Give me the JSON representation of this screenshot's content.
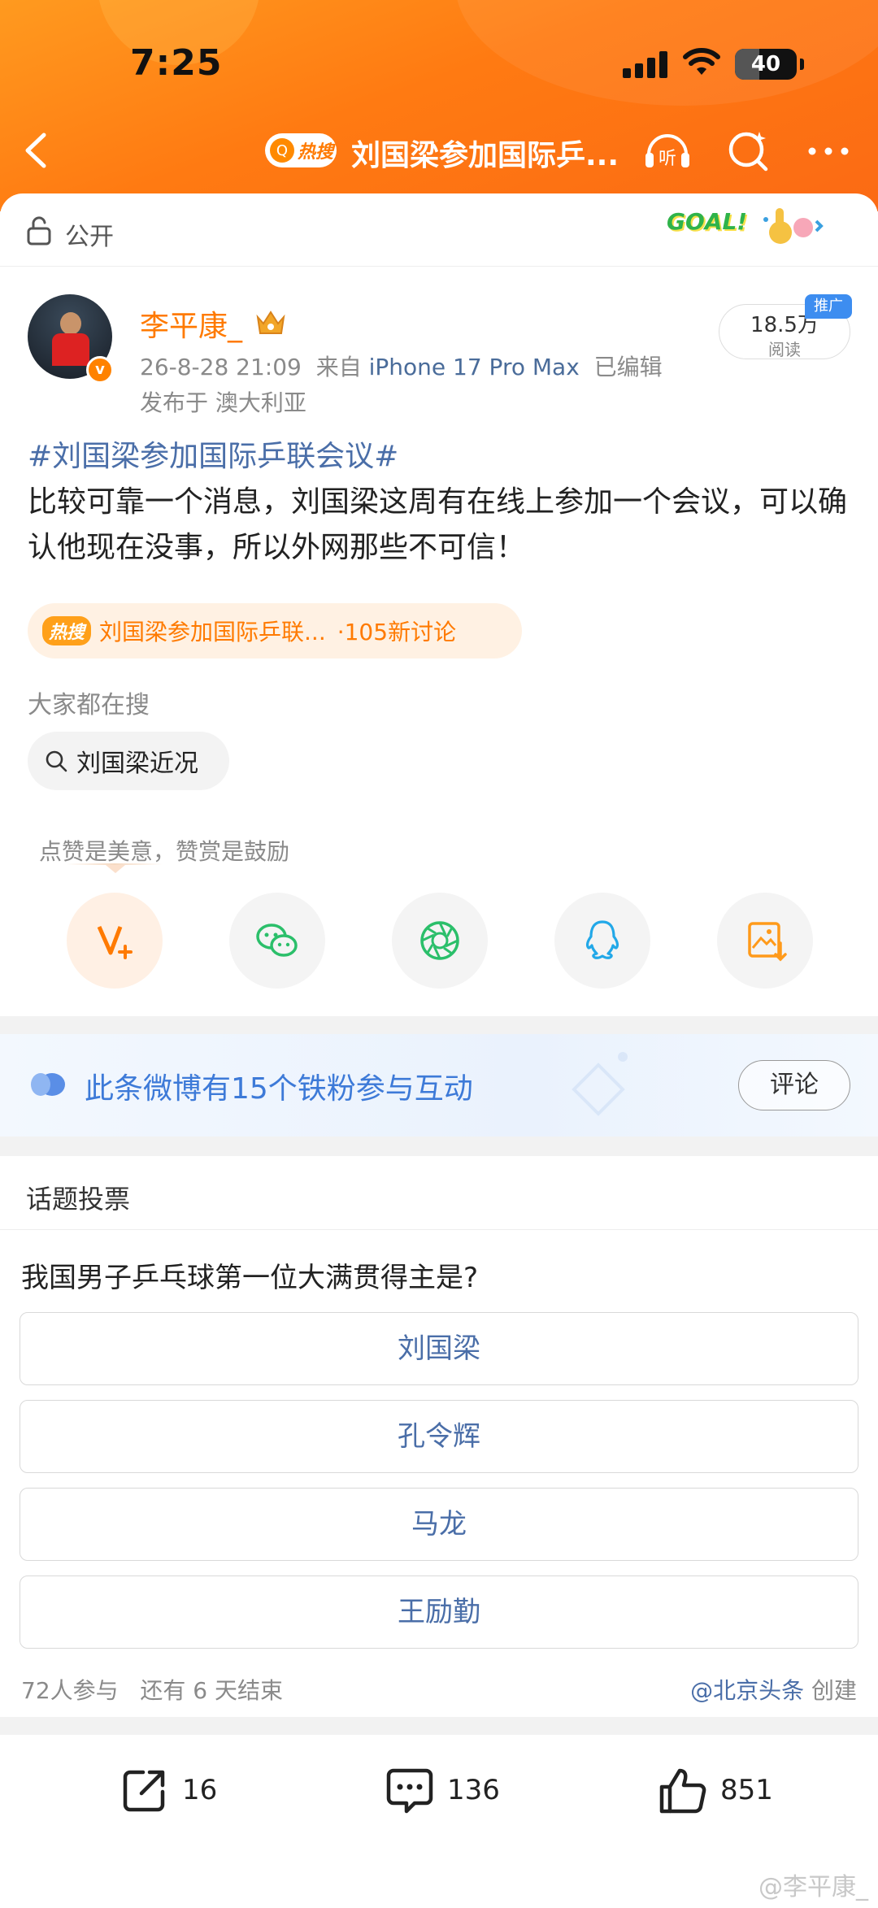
{
  "status_bar": {
    "time": "7:25",
    "battery": "40"
  },
  "header": {
    "hot_badge": "热搜",
    "title": "刘国梁参加国际乒...",
    "listen_label": "听"
  },
  "privacy": {
    "label": "公开",
    "goal_text": "GOAL!"
  },
  "post": {
    "author": "李平康_",
    "verified_mark": "v",
    "date": "26-8-28 21:09",
    "source_prefix": "来自",
    "device": "iPhone 17 Pro Max",
    "edited": "已编辑",
    "location": "发布于 澳大利亚",
    "reads_count": "18.5万",
    "reads_label": "阅读",
    "promo_badge": "推广",
    "hashtag": "#刘国梁参加国际乒联会议#",
    "body": "比较可靠一个消息，刘国梁这周有在线上参加一个会议，可以确认他现在没事，所以外网那些不可信！"
  },
  "hot_topic": {
    "badge": "热搜",
    "text": "刘国梁参加国际乒联...",
    "count": "·105新讨论"
  },
  "searches": {
    "label": "大家都在搜",
    "chip": "刘国梁近况"
  },
  "reward": {
    "tip": "点赞是美意，赞赏是鼓励"
  },
  "share_icons": [
    "reward-v-plus-icon",
    "wechat-icon",
    "moments-icon",
    "qq-icon",
    "save-image-icon"
  ],
  "fans": {
    "text": "此条微博有15个铁粉参与互动",
    "button": "评论"
  },
  "vote": {
    "header": "话题投票",
    "question": "我国男子乒乓球第一位大满贯得主是?",
    "options": [
      "刘国梁",
      "孔令辉",
      "马龙",
      "王励勤"
    ],
    "participants": "72人参与",
    "remaining": "还有 6 天结束",
    "creator_account": "@北京头条",
    "creator_suffix": "创建"
  },
  "actions": {
    "repost_count": "16",
    "comment_count": "136",
    "like_count": "851"
  },
  "watermark": "@李平康_",
  "colors": {
    "brand_orange": "#ff7a00",
    "link_blue": "#4a6ea8",
    "fans_blue": "#3d7ad8"
  }
}
